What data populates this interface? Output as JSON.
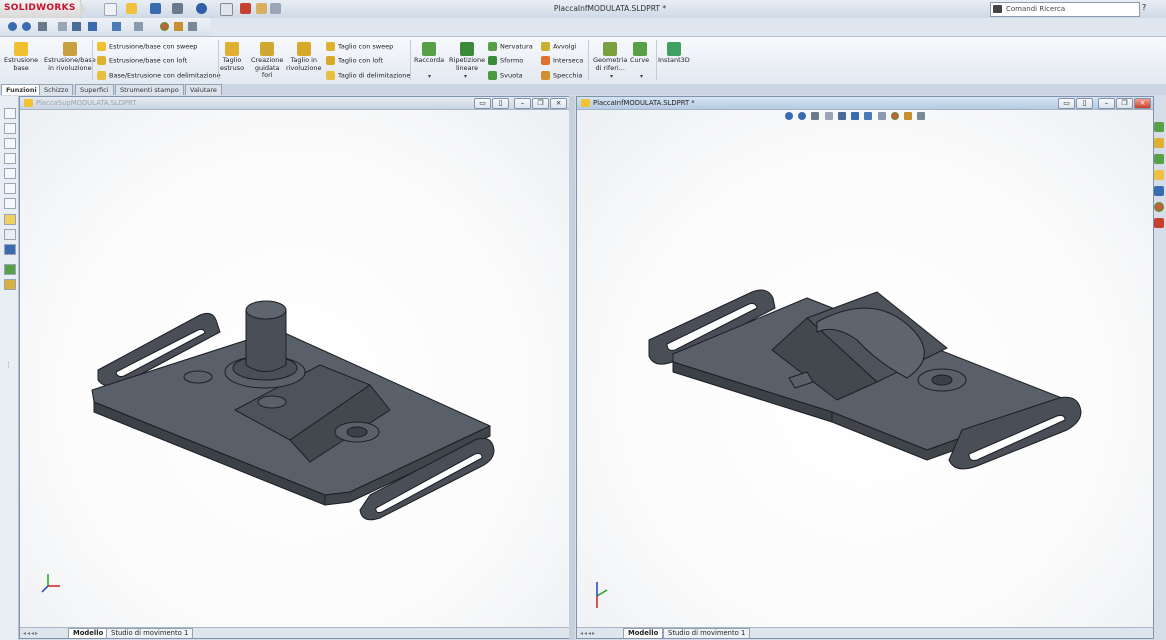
{
  "app": {
    "logo_text": "SOLIDWORKS",
    "document_title": "PlaccaInfMODULATA.SLDPRT *",
    "search_placeholder": "Comandi Ricerca",
    "help_label": "?"
  },
  "command_manager": {
    "large_buttons": [
      {
        "id": "estrusione-base",
        "label": "Estrusione\nbase",
        "color": "#f0c030"
      },
      {
        "id": "estrusione-rivoluzione",
        "label": "Estrusione/base\nin rivoluzione",
        "color": "#c8a040"
      },
      {
        "id": "taglio-estruso",
        "label": "Taglio\nestruso",
        "color": "#e0b030"
      },
      {
        "id": "creazione-guidata-fori",
        "label": "Creazione\nguidata\nfori",
        "color": "#d0a830"
      },
      {
        "id": "taglio-rivoluzione",
        "label": "Taglio in\nrivoluzione",
        "color": "#d8a828"
      },
      {
        "id": "raccorda",
        "label": "Raccorda",
        "color": "#58a048"
      },
      {
        "id": "ripetizione-lineare",
        "label": "Ripetizione\nlineare",
        "color": "#3a8a3a"
      },
      {
        "id": "geometria-riferimento",
        "label": "Geometria\ndi riferi...",
        "color": "#7aa040"
      },
      {
        "id": "curve",
        "label": "Curve",
        "color": "#58a048"
      },
      {
        "id": "instant3d",
        "label": "Instant3D",
        "color": "#40a060"
      }
    ],
    "column1": [
      "Estrusione/base con sweep",
      "Estrusione/base con loft",
      "Base/Estrusione con delimitazione"
    ],
    "column2": [
      "Taglio con sweep",
      "Taglio con loft",
      "Taglio di delimitazione"
    ],
    "column3": [
      "Nervatura",
      "Sformo",
      "Svuota"
    ],
    "column4": [
      "Avvolgi",
      "Interseca",
      "Specchia"
    ]
  },
  "tabs": [
    "Funzioni",
    "Schizzo",
    "Superfici",
    "Strumenti stampo",
    "Valutare"
  ],
  "windows": {
    "left": {
      "title": "PlaccaSupMODULATA.SLDPRT"
    },
    "right": {
      "title": "PlaccaInfMODULATA.SLDPRT *"
    }
  },
  "bottom_tabs": [
    "Modello",
    "Studio di movimento 1"
  ],
  "colors": {
    "model_fill": "#4a4f57",
    "model_top": "#5a606a",
    "model_edge": "#1c1f24",
    "accent_red": "#c8102e"
  }
}
